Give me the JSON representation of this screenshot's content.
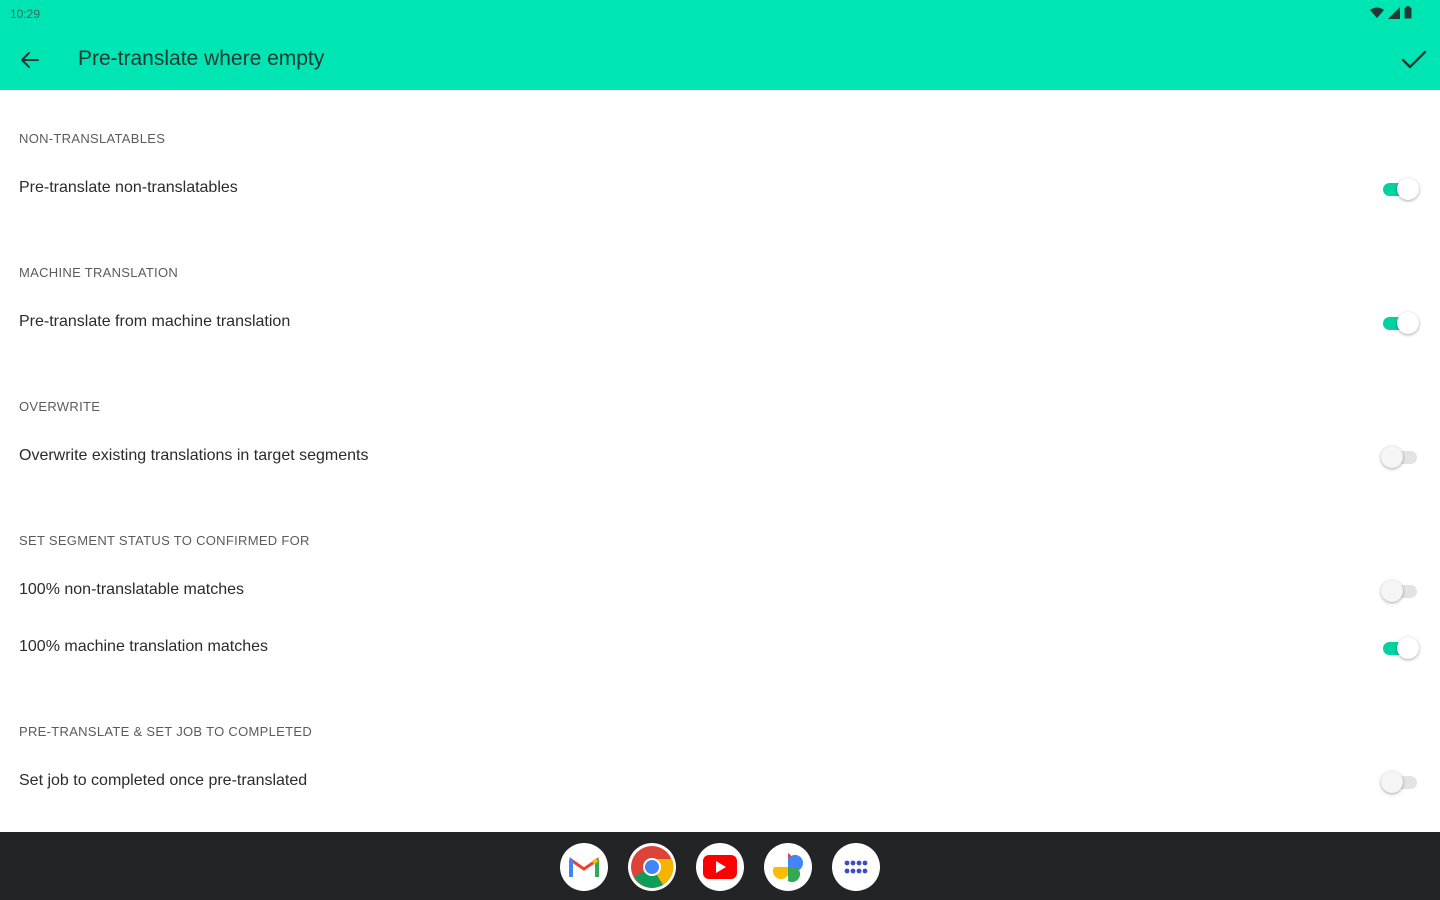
{
  "status_bar": {
    "time": "10:29",
    "icons": [
      "wifi-icon",
      "signal-icon",
      "battery-icon"
    ]
  },
  "appbar": {
    "title": "Pre-translate where empty",
    "back_icon": "arrow-left-icon",
    "confirm_icon": "check-icon",
    "color": "#00e5b4"
  },
  "sections": [
    {
      "header": "NON-TRANSLATABLES",
      "items": [
        {
          "label": "Pre-translate non-translatables",
          "on": true
        }
      ]
    },
    {
      "header": "MACHINE TRANSLATION",
      "items": [
        {
          "label": "Pre-translate from machine translation",
          "on": true
        }
      ]
    },
    {
      "header": "OVERWRITE",
      "items": [
        {
          "label": "Overwrite existing translations in target segments",
          "on": false
        }
      ]
    },
    {
      "header": "SET SEGMENT STATUS TO CONFIRMED FOR",
      "items": [
        {
          "label": "100% non-translatable matches",
          "on": false
        },
        {
          "label": "100% machine translation matches",
          "on": true
        }
      ]
    },
    {
      "header": "PRE-TRANSLATE & SET JOB TO COMPLETED",
      "items": [
        {
          "label": "Set job to completed once pre-translated",
          "on": false
        }
      ]
    }
  ],
  "colors": {
    "switch_on": "#00d2a2",
    "switch_off_track": "#e3e3e3",
    "nav_bar": "#222426"
  },
  "dock": [
    {
      "name": "gmail-icon"
    },
    {
      "name": "chrome-icon"
    },
    {
      "name": "youtube-icon"
    },
    {
      "name": "photos-icon"
    },
    {
      "name": "app-drawer-icon"
    }
  ]
}
